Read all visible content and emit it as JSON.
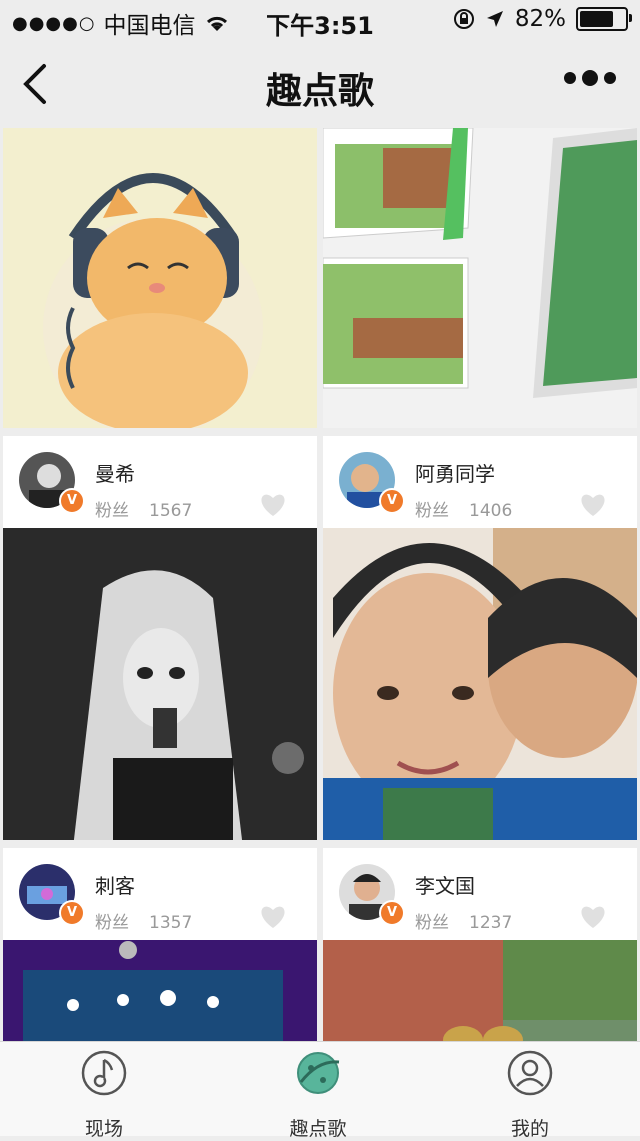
{
  "status": {
    "carrier": "中国电信",
    "signal": "●●●●○",
    "time": "下午3:51",
    "battery_text": "82%",
    "battery_level": 0.82
  },
  "nav": {
    "title": "趣点歌"
  },
  "cards": [
    {
      "name": "曼希",
      "fans_label": "粉丝",
      "fans": "1567"
    },
    {
      "name": "阿勇同学",
      "fans_label": "粉丝",
      "fans": "1406"
    },
    {
      "name": "刺客",
      "fans_label": "粉丝",
      "fans": "1357"
    },
    {
      "name": "李文国",
      "fans_label": "粉丝",
      "fans": "1237"
    }
  ],
  "tabs": [
    {
      "label": "现场"
    },
    {
      "label": "趣点歌"
    },
    {
      "label": "我的"
    }
  ],
  "colors": {
    "badge": "#f07a2a",
    "tab_active": "#3f8f7a"
  }
}
